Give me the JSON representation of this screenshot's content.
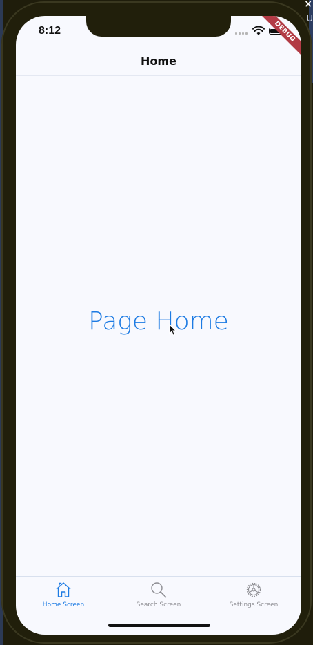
{
  "status_bar": {
    "time": "8:12"
  },
  "debug_banner": "DEBUG",
  "nav": {
    "title": "Home"
  },
  "main": {
    "text": "Page Home"
  },
  "tabs": [
    {
      "label": "Home Screen",
      "icon": "home-icon",
      "active": true
    },
    {
      "label": "Search Screen",
      "icon": "search-icon",
      "active": false
    },
    {
      "label": "Settings Screen",
      "icon": "settings-icon",
      "active": false
    }
  ],
  "desktop": {
    "close_glyph": "×",
    "partial_letter": "U"
  },
  "colors": {
    "accent": "#1d7be3",
    "inactive": "#8e8e93",
    "background": "#f8f9fe",
    "debug": "#b23b45"
  }
}
